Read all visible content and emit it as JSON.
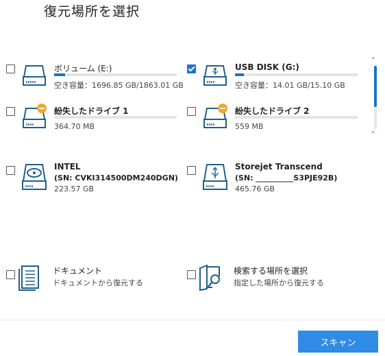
{
  "page": {
    "title": "復元場所を選択"
  },
  "drives": [
    {
      "name": "ボリューム (E:)",
      "detail": "空き容量：1696.85 GB/1863.01 GB",
      "checked": false,
      "usage": 0.09
    },
    {
      "name": "USB DISK (G:)",
      "detail": "空き容量：14.01 GB/15.10 GB",
      "checked": true,
      "usage": 0.07
    },
    {
      "name": "紛失したドライブ 1",
      "detail": "364.70 MB",
      "checked": false
    },
    {
      "name": "紛失したドライブ 2",
      "detail": "559 MB",
      "checked": false
    },
    {
      "name": "INTEL",
      "serial": "(SN: CVKI314500DM240DGN)",
      "detail": "223.57 GB",
      "checked": false
    },
    {
      "name": "Storejet Transcend",
      "serial": "(SN: __________S3PJE92B)",
      "detail": "465.76 GB",
      "checked": false
    }
  ],
  "options": [
    {
      "title": "ドキュメント",
      "subtitle": "ドキュメントから復元する",
      "icon": "document-icon"
    },
    {
      "title": "検索する場所を選択",
      "subtitle": "指定した場所から復元する",
      "icon": "folder-search-icon"
    }
  ],
  "scrollbar": {
    "up": "˄",
    "down": "˅"
  },
  "footer": {
    "scan_label": "スキャン"
  },
  "colors": {
    "accent": "#1a73c9",
    "button": "#2f8be6",
    "warning": "#f5a623",
    "icon": "#1f5f8b"
  }
}
